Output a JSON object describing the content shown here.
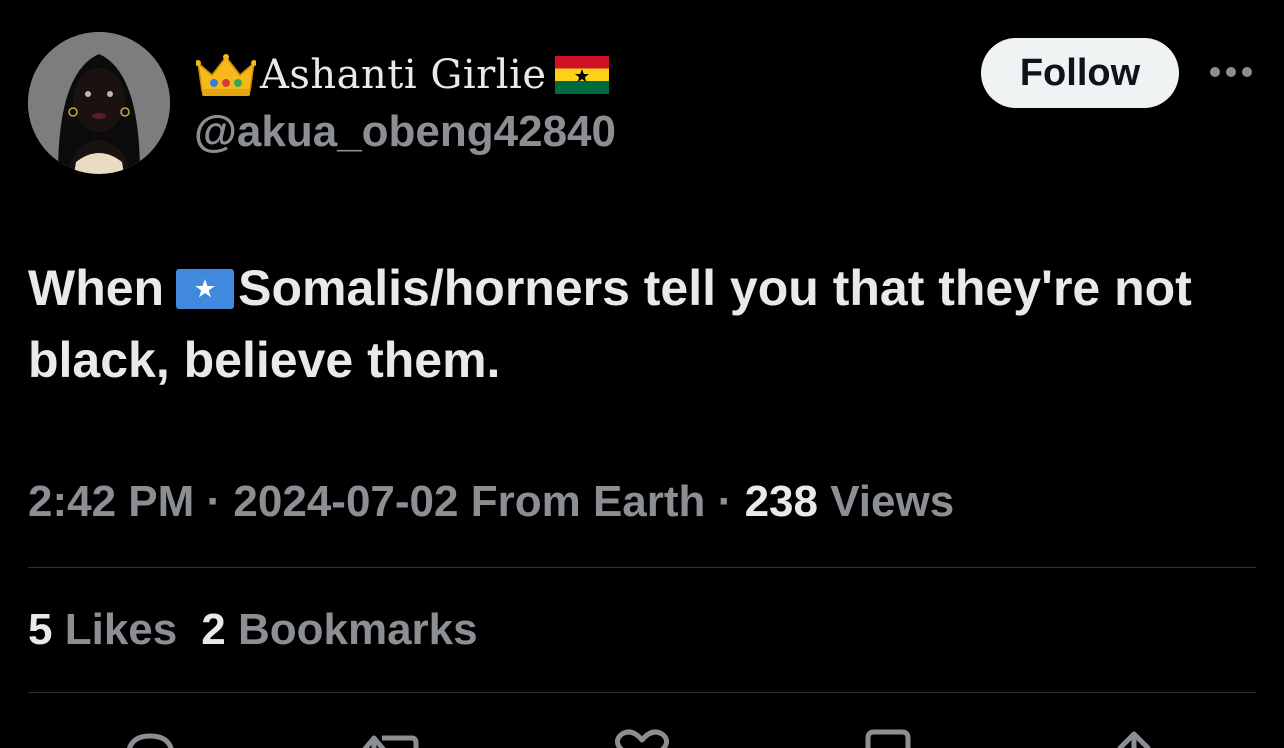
{
  "author": {
    "display_name": "Ashanti Girlie",
    "handle": "@akua_obeng42840",
    "avatar_icon": "avatar-portrait",
    "name_prefix_icon": "crown-emoji",
    "name_suffix_icon": "ghana-flag-emoji"
  },
  "follow_label": "Follow",
  "more_icon": "ellipsis-icon",
  "tweet": {
    "text_before": "When",
    "inline_icon": "somalia-flag-emoji",
    "text_after": "Somalis/horners tell you that they're not black, believe them."
  },
  "meta": {
    "time": "2:42 PM",
    "sep1": "·",
    "date": "2024-07-02",
    "source": "From Earth",
    "sep2": "·",
    "views_count": "238",
    "views_label": "Views"
  },
  "stats": {
    "likes_count": "5",
    "likes_label": "Likes",
    "bookmarks_count": "2",
    "bookmarks_label": "Bookmarks"
  },
  "actions": [
    "reply-icon",
    "retweet-icon",
    "like-icon",
    "bookmark-icon",
    "share-icon"
  ],
  "colors": {
    "background": "#000000",
    "primary_text": "#e7e9ea",
    "secondary_text": "#8b8f94",
    "divider": "#2f3336",
    "follow_bg": "#eff3f4"
  }
}
